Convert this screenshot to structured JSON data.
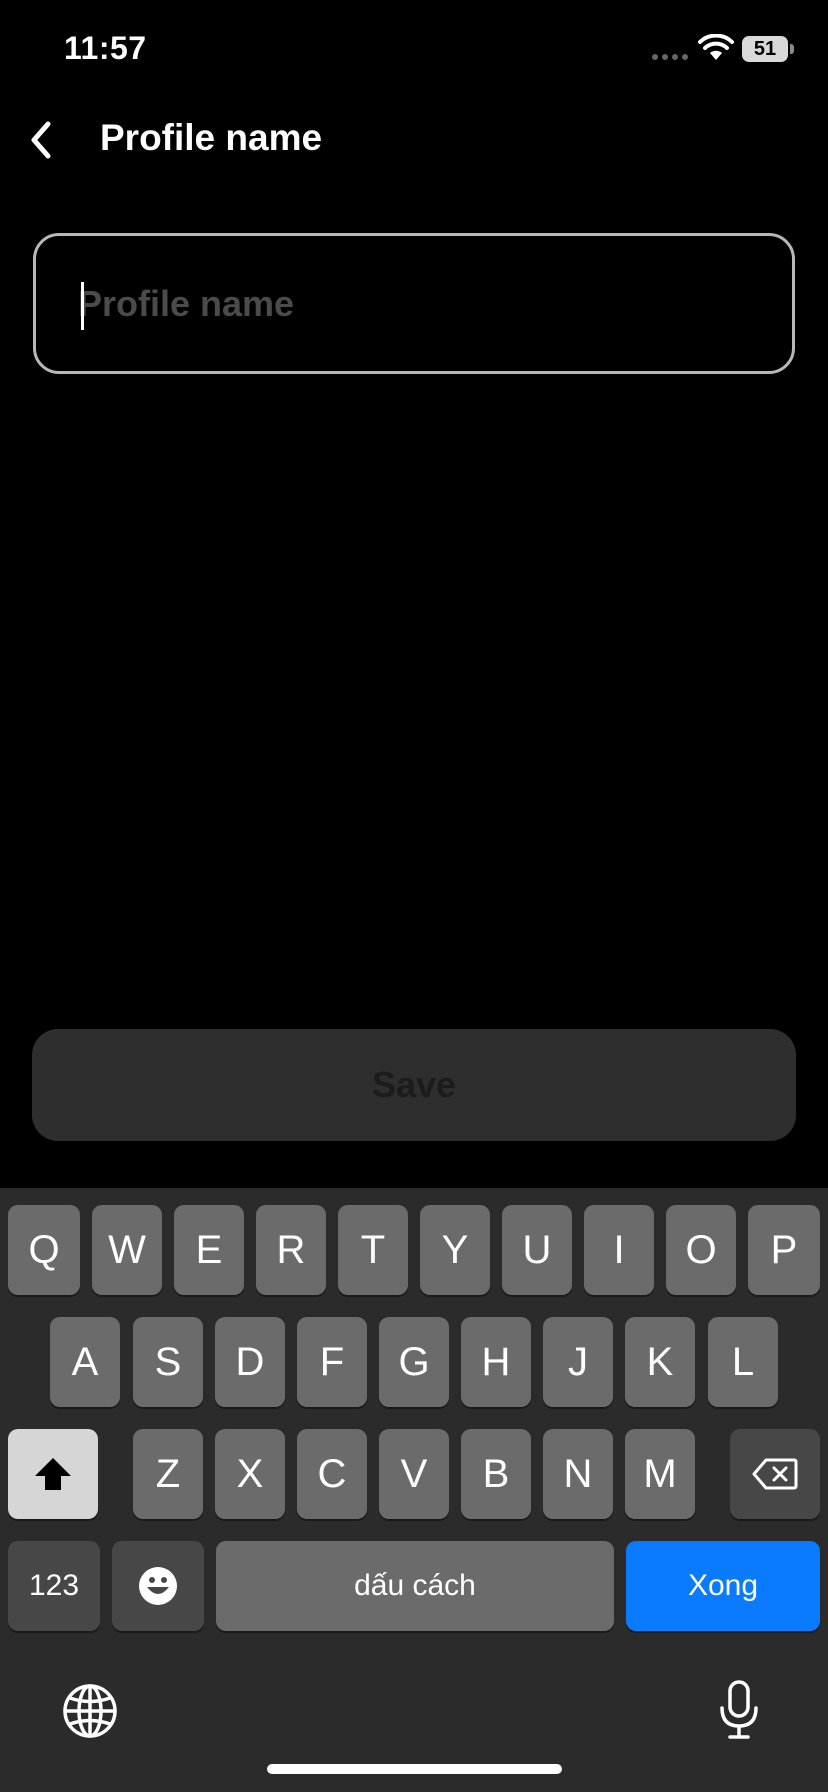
{
  "status_bar": {
    "time": "11:57",
    "battery": "51"
  },
  "header": {
    "title": "Profile name"
  },
  "form": {
    "name_value": "",
    "name_placeholder": "Profile name",
    "save_label": "Save"
  },
  "keyboard": {
    "row1": [
      "Q",
      "W",
      "E",
      "R",
      "T",
      "Y",
      "U",
      "I",
      "O",
      "P"
    ],
    "row2": [
      "A",
      "S",
      "D",
      "F",
      "G",
      "H",
      "J",
      "K",
      "L"
    ],
    "row3": [
      "Z",
      "X",
      "C",
      "V",
      "B",
      "N",
      "M"
    ],
    "numbers_label": "123",
    "space_label": "dấu cách",
    "done_label": "Xong",
    "accent_color": "#0a7aff"
  },
  "icons": [
    "chevron-left-icon",
    "wifi-icon",
    "battery-icon",
    "shift-icon",
    "delete-icon",
    "emoji-icon",
    "globe-icon",
    "mic-icon"
  ]
}
